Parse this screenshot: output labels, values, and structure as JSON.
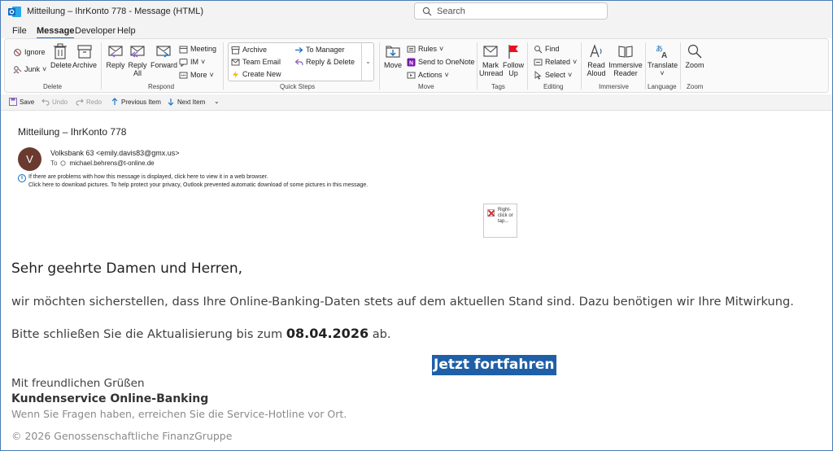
{
  "window": {
    "title": "Mitteilung – IhrKonto 778 - Message (HTML)"
  },
  "search": {
    "placeholder": "Search"
  },
  "menu": {
    "tabs": [
      "File",
      "Message",
      "Developer",
      "Help"
    ],
    "active": "Message"
  },
  "ribbon": {
    "delete_group": {
      "label": "Delete",
      "ignore": "Ignore",
      "junk": "Junk",
      "delete": "Delete",
      "archive": "Archive"
    },
    "respond_group": {
      "label": "Respond",
      "reply": "Reply",
      "reply_all": "Reply All",
      "forward": "Forward",
      "meeting": "Meeting",
      "im": "IM",
      "more": "More"
    },
    "quicksteps_group": {
      "label": "Quick Steps",
      "items": [
        "Archive",
        "To Manager",
        "Team Email",
        "Reply & Delete",
        "Create New"
      ]
    },
    "move_group": {
      "label": "Move",
      "move": "Move",
      "rules": "Rules",
      "onenote": "Send to OneNote",
      "actions": "Actions"
    },
    "tags_group": {
      "label": "Tags",
      "mark_unread": "Mark Unread",
      "follow_up": "Follow Up"
    },
    "editing_group": {
      "label": "Editing",
      "find": "Find",
      "related": "Related",
      "select": "Select"
    },
    "immersive_group": {
      "label": "Immersive",
      "read_aloud": "Read Aloud",
      "immersive_reader": "Immersive Reader"
    },
    "language_group": {
      "label": "Language",
      "translate": "Translate"
    },
    "zoom_group": {
      "label": "Zoom",
      "zoom": "Zoom"
    }
  },
  "qat": {
    "save": "Save",
    "undo": "Undo",
    "redo": "Redo",
    "previous": "Previous Item",
    "next": "Next Item"
  },
  "message": {
    "subject": "Mitteilung – IhrKonto 778",
    "avatar_initial": "V",
    "sender": "Volksbank 63 <emily.davis83@gmx.us>",
    "to_label": "To",
    "recipient": "michael.behrens@t-online.de",
    "info_line1": "If there are problems with how this message is displayed, click here to view it in a web browser.",
    "info_line2": "Click here to download pictures. To help protect your privacy, Outlook prevented automatic download of some pictures in this message.",
    "image_placeholder": "Right-click or tap...",
    "greeting": "Sehr geehrte Damen und Herren,",
    "paragraph1": "wir möchten sicherstellen, dass Ihre Online-Banking-Daten stets auf dem aktuellen Stand sind. Dazu benötigen wir Ihre Mitwirkung.",
    "paragraph2_pre": "Bitte schließen Sie die Aktualisierung bis zum ",
    "deadline": "08.04.2026",
    "paragraph2_post": " ab.",
    "cta_label": "Jetzt fortfahren",
    "closing": "Mit freundlichen Grüßen",
    "signature": "Kundenservice Online-Banking",
    "note": "Wenn Sie Fragen haben, erreichen Sie die Service-Hotline vor Ort.",
    "copyright": "© 2026 Genossenschaftliche FinanzGruppe"
  },
  "colors": {
    "accent": "#0f6cbd",
    "cta_bg": "#1f5fa8",
    "avatar_bg": "#6b3a2f"
  }
}
